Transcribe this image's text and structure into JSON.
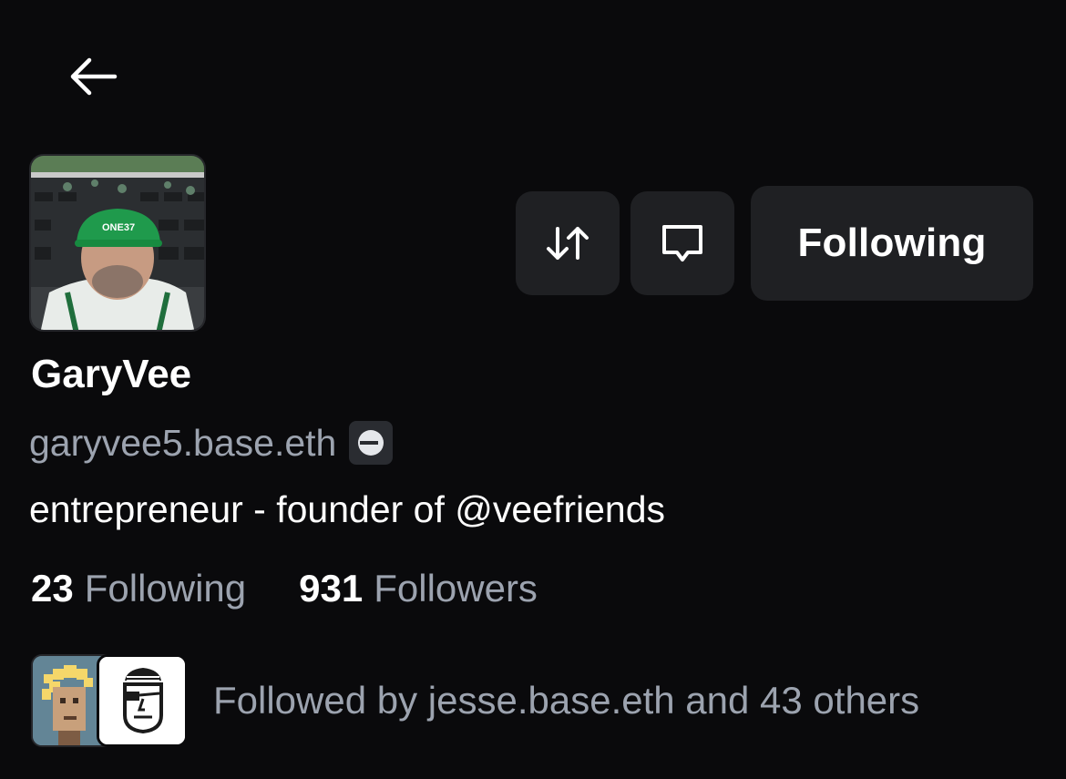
{
  "profile": {
    "display_name": "GaryVee",
    "handle": "garyvee5.base.eth",
    "bio": "entrepreneur - founder of @veefriends",
    "avatar_icon": "profile-photo"
  },
  "actions": {
    "swap_icon": "swap-arrows-icon",
    "message_icon": "message-bubble-icon",
    "follow_label": "Following"
  },
  "stats": {
    "following_count": "23",
    "following_label": "Following",
    "followers_count": "931",
    "followers_label": "Followers"
  },
  "followed_by": {
    "text": "Followed by jesse.base.eth and 43 others"
  },
  "colors": {
    "background": "#0a0a0c",
    "button_bg": "#1f2023",
    "muted_text": "#9ca3af",
    "primary_text": "#ffffff"
  }
}
